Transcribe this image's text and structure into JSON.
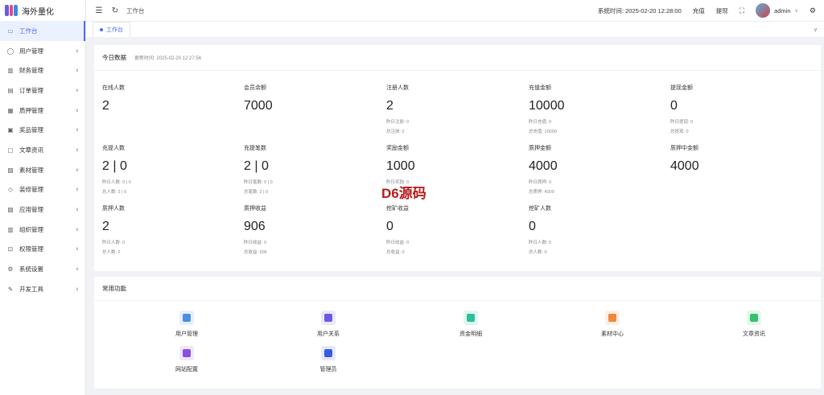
{
  "app": {
    "name": "海外量化"
  },
  "sidebar": {
    "items": [
      {
        "label": "工作台",
        "icon": "monitor-icon",
        "active": true,
        "expandable": false
      },
      {
        "label": "用户管理",
        "icon": "user-icon",
        "expandable": true
      },
      {
        "label": "财务管理",
        "icon": "chart-icon",
        "expandable": true
      },
      {
        "label": "订单管理",
        "icon": "order-icon",
        "expandable": true
      },
      {
        "label": "质押管理",
        "icon": "pledge-icon",
        "expandable": true
      },
      {
        "label": "奖品管理",
        "icon": "gift-icon",
        "expandable": true
      },
      {
        "label": "文章资讯",
        "icon": "article-icon",
        "expandable": true
      },
      {
        "label": "素材管理",
        "icon": "image-icon",
        "expandable": true
      },
      {
        "label": "装修管理",
        "icon": "decorate-icon",
        "expandable": true
      },
      {
        "label": "应用管理",
        "icon": "app-icon",
        "expandable": true
      },
      {
        "label": "组织管理",
        "icon": "org-icon",
        "expandable": true
      },
      {
        "label": "权限管理",
        "icon": "lock-icon",
        "expandable": true
      },
      {
        "label": "系统设置",
        "icon": "gear-icon",
        "expandable": true
      },
      {
        "label": "开发工具",
        "icon": "tool-icon",
        "expandable": true
      }
    ]
  },
  "header": {
    "breadcrumb": "工作台",
    "system_time_label": "系统时间:",
    "system_time": "2025-02-20 12:28:00",
    "recharge": "充值",
    "withdraw": "提现",
    "username": "admin"
  },
  "tabs": [
    {
      "label": "工作台"
    }
  ],
  "today": {
    "title": "今日数据",
    "updated_label": "更新时间:",
    "updated_time": "2025-02-20 12:27:56",
    "stats": [
      {
        "label": "在线人数",
        "value": "2",
        "subs": []
      },
      {
        "label": "会员余额",
        "value": "7000",
        "subs": []
      },
      {
        "label": "注册人数",
        "value": "2",
        "subs": [
          "昨日注册: 0",
          "总注册: 2"
        ]
      },
      {
        "label": "充值金额",
        "value": "10000",
        "subs": [
          "昨日充值: 0",
          "总充值: 10000"
        ]
      },
      {
        "label": "提现金额",
        "value": "0",
        "subs": [
          "昨日提现: 0",
          "总提现: 0"
        ]
      },
      {
        "label": "充提人数",
        "value": "2 | 0",
        "subs": [
          "昨日人数: 0 | 0",
          "总人数: 2 | 0"
        ]
      },
      {
        "label": "充提笔数",
        "value": "2 | 0",
        "subs": [
          "昨日笔数: 0 | 0",
          "总笔数: 2 | 0"
        ]
      },
      {
        "label": "奖励金额",
        "value": "1000",
        "subs": [
          "昨日奖励: 0",
          ""
        ]
      },
      {
        "label": "质押金额",
        "value": "4000",
        "subs": [
          "昨日质押: 0",
          "总质押: 4000"
        ]
      },
      {
        "label": "质押中金额",
        "value": "4000",
        "subs": []
      },
      {
        "label": "质押人数",
        "value": "2",
        "subs": [
          "昨日人数: 0",
          "总人数: 2"
        ]
      },
      {
        "label": "质押收益",
        "value": "906",
        "subs": [
          "昨日收益: 0",
          "总收益: 906"
        ]
      },
      {
        "label": "挖矿收益",
        "value": "0",
        "subs": [
          "昨日收益: 0",
          "总收益: 0"
        ]
      },
      {
        "label": "挖矿人数",
        "value": "0",
        "subs": [
          "昨日人数: 0",
          "总人数: 0"
        ]
      }
    ]
  },
  "functions": {
    "title": "常用功能",
    "items": [
      {
        "label": "用户管理",
        "icon": "user-manage-icon",
        "color": "#4a90e2"
      },
      {
        "label": "用户关系",
        "icon": "user-relation-icon",
        "color": "#6b5be2"
      },
      {
        "label": "资金明细",
        "icon": "funds-icon",
        "color": "#2bbf9a"
      },
      {
        "label": "素材中心",
        "icon": "material-icon",
        "color": "#f0883a"
      },
      {
        "label": "文章资讯",
        "icon": "article-news-icon",
        "color": "#36c06b"
      },
      {
        "label": "网站配置",
        "icon": "site-config-icon",
        "color": "#8a4fe0"
      },
      {
        "label": "管理员",
        "icon": "admin-icon",
        "color": "#3a5be0"
      }
    ]
  },
  "watermark": "D6源码"
}
